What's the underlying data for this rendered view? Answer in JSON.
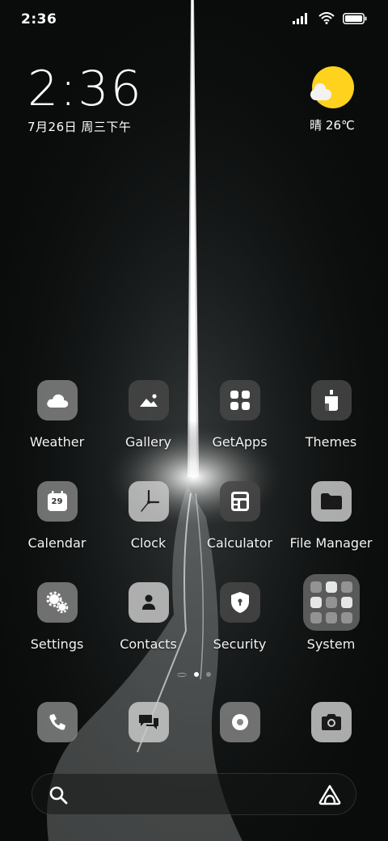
{
  "status_bar": {
    "time": "2:36",
    "icons": [
      "signal-icon",
      "wifi-icon",
      "battery-icon"
    ]
  },
  "clock_widget": {
    "time": "2:36",
    "date": "7月26日 周三下午"
  },
  "weather_widget": {
    "condition": "晴",
    "temperature": "26℃",
    "icon": "sunny-cloud-icon",
    "sun_color": "#ffd21e"
  },
  "apps": [
    {
      "label": "Weather",
      "icon": "cloud-icon"
    },
    {
      "label": "Gallery",
      "icon": "mountain-image-icon"
    },
    {
      "label": "GetApps",
      "icon": "apps-grid-icon"
    },
    {
      "label": "Themes",
      "icon": "paint-bucket-icon"
    },
    {
      "label": "Calendar",
      "icon": "calendar-icon",
      "badge": "29"
    },
    {
      "label": "Clock",
      "icon": "clock-icon"
    },
    {
      "label": "Calculator",
      "icon": "calculator-icon"
    },
    {
      "label": "File Manager",
      "icon": "folder-icon"
    },
    {
      "label": "Settings",
      "icon": "gears-icon"
    },
    {
      "label": "Contacts",
      "icon": "person-icon"
    },
    {
      "label": "Security",
      "icon": "shield-icon"
    },
    {
      "label": "System",
      "icon": "app-folder-icon"
    }
  ],
  "dock": [
    {
      "icon": "phone-icon"
    },
    {
      "icon": "messages-icon"
    },
    {
      "icon": "browser-icon"
    },
    {
      "icon": "camera-icon"
    }
  ],
  "page_indicator": {
    "pages": 2,
    "current": 1
  },
  "search_bar": {
    "left_icon": "search-icon",
    "right_icon": "app-vault-icon"
  }
}
